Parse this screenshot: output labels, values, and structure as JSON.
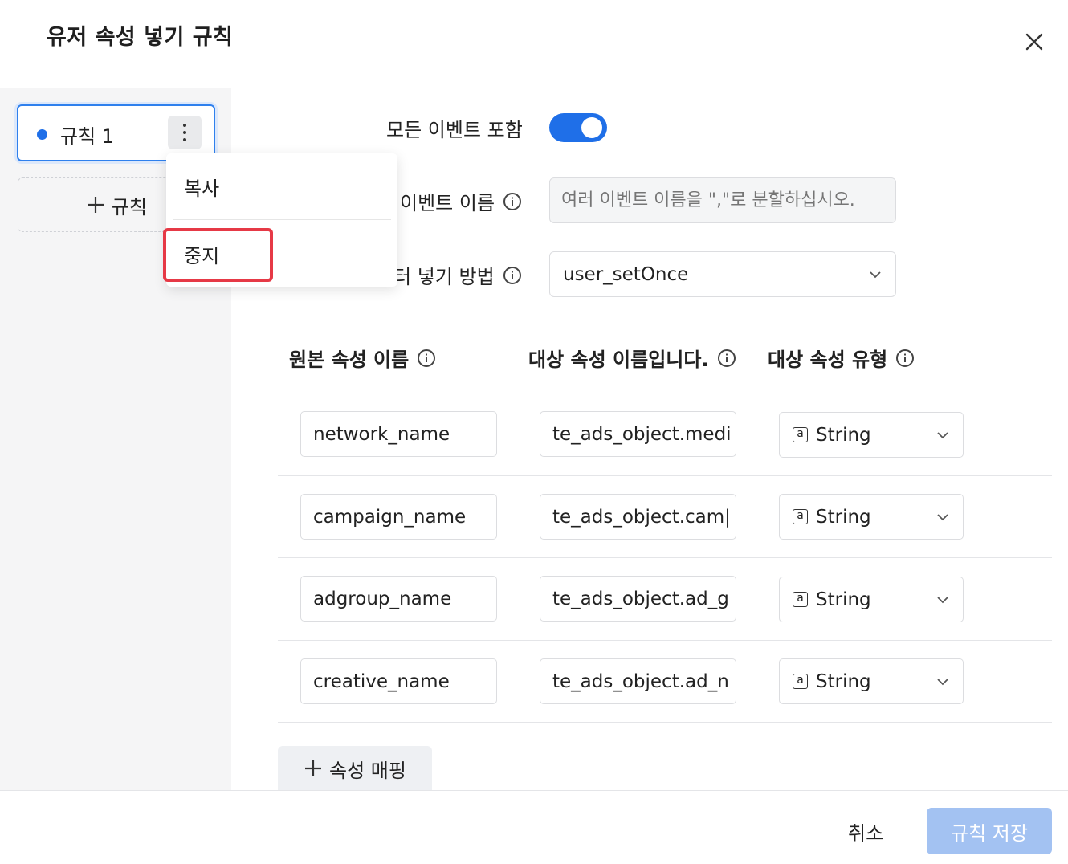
{
  "dialog": {
    "title": "유저 속성 넣기 규칙"
  },
  "sidebar": {
    "rules": [
      {
        "label": "규칙 1"
      }
    ],
    "add_rule_label": "규칙"
  },
  "context_menu": {
    "items": [
      {
        "label": "복사"
      },
      {
        "label": "중지"
      }
    ]
  },
  "form": {
    "include_all_events_label": "모든 이벤트 포함",
    "include_all_events_on": true,
    "event_name_label": "이벤트 이름",
    "event_name_placeholder": "여러 이벤트 이름을 \",\"로 분할하십시오.",
    "method_label": "터 넣기 방법",
    "method_value": "user_setOnce"
  },
  "table": {
    "headers": [
      "원본 속성 이름",
      "대상 속성 이름입니다.",
      "대상 속성 유형"
    ],
    "rows": [
      {
        "source": "network_name",
        "target": "te_ads_object.medi",
        "type": "String"
      },
      {
        "source": "campaign_name",
        "target": "te_ads_object.cam|",
        "type": "String"
      },
      {
        "source": "adgroup_name",
        "target": "te_ads_object.ad_g",
        "type": "String"
      },
      {
        "source": "creative_name",
        "target": "te_ads_object.ad_n",
        "type": "String"
      }
    ],
    "add_mapping_label": "속성 매핑"
  },
  "footer": {
    "cancel_label": "취소",
    "save_label": "규칙 저장"
  },
  "colors": {
    "accent": "#1f6fe8",
    "save_disabled": "#a3c2f2",
    "highlight": "#e63946"
  }
}
